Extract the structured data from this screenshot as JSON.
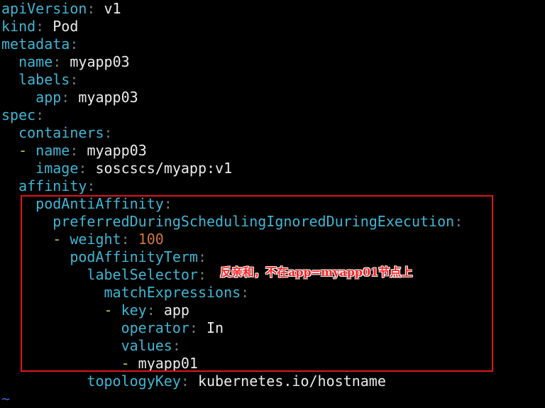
{
  "editor": {
    "lines": [
      {
        "indent": "",
        "dash": "",
        "key": "apiVersion",
        "value": "v1",
        "value_type": "str"
      },
      {
        "indent": "",
        "dash": "",
        "key": "kind",
        "value": "Pod",
        "value_type": "str"
      },
      {
        "indent": "",
        "dash": "",
        "key": "metadata",
        "value": "",
        "value_type": "str"
      },
      {
        "indent": "  ",
        "dash": "",
        "key": "name",
        "value": "myapp03",
        "value_type": "str"
      },
      {
        "indent": "  ",
        "dash": "",
        "key": "labels",
        "value": "",
        "value_type": "str"
      },
      {
        "indent": "    ",
        "dash": "",
        "key": "app",
        "value": "myapp03",
        "value_type": "str"
      },
      {
        "indent": "",
        "dash": "",
        "key": "spec",
        "value": "",
        "value_type": "str"
      },
      {
        "indent": "  ",
        "dash": "",
        "key": "containers",
        "value": "",
        "value_type": "str"
      },
      {
        "indent": "  ",
        "dash": "-",
        "key": "name",
        "value": "myapp03",
        "value_type": "str"
      },
      {
        "indent": "    ",
        "dash": "",
        "key": "image",
        "value": "soscscs/myapp:v1",
        "value_type": "str"
      },
      {
        "indent": "  ",
        "dash": "",
        "key": "affinity",
        "value": "",
        "value_type": "str"
      },
      {
        "indent": "    ",
        "dash": "",
        "key": "podAntiAffinity",
        "value": "",
        "value_type": "str"
      },
      {
        "indent": "      ",
        "dash": "",
        "key": "preferredDuringSchedulingIgnoredDuringExecution",
        "value": "",
        "value_type": "str"
      },
      {
        "indent": "      ",
        "dash": "-",
        "key": "weight",
        "value": "100",
        "value_type": "num"
      },
      {
        "indent": "        ",
        "dash": "",
        "key": "podAffinityTerm",
        "value": "",
        "value_type": "str"
      },
      {
        "indent": "          ",
        "dash": "",
        "key": "labelSelector",
        "value": "",
        "value_type": "str"
      },
      {
        "indent": "            ",
        "dash": "",
        "key": "matchExpressions",
        "value": "",
        "value_type": "str"
      },
      {
        "indent": "            ",
        "dash": "-",
        "key": "key",
        "value": "app",
        "value_type": "str"
      },
      {
        "indent": "              ",
        "dash": "",
        "key": "operator",
        "value": "In",
        "value_type": "str"
      },
      {
        "indent": "              ",
        "dash": "",
        "key": "values",
        "value": "",
        "value_type": "str"
      },
      {
        "indent": "              ",
        "dash": "-",
        "key": "",
        "value": "myapp01",
        "value_type": "str"
      },
      {
        "indent": "          ",
        "dash": "",
        "key": "topologyKey",
        "value": "kubernetes.io/hostname",
        "value_type": "str"
      }
    ],
    "tilde": "~"
  },
  "annotation": {
    "text": "反亲和，不在app=myapp01节点上"
  },
  "colors": {
    "background": "#000000",
    "key": "#3fb6d4",
    "punctuation": "#6f7f82",
    "value": "#ececec",
    "number": "#d0773a",
    "list_dash": "#c9c93a",
    "tilde": "#4f5ad8",
    "highlight_border": "#e0141e",
    "annotation": "#ff2222"
  }
}
